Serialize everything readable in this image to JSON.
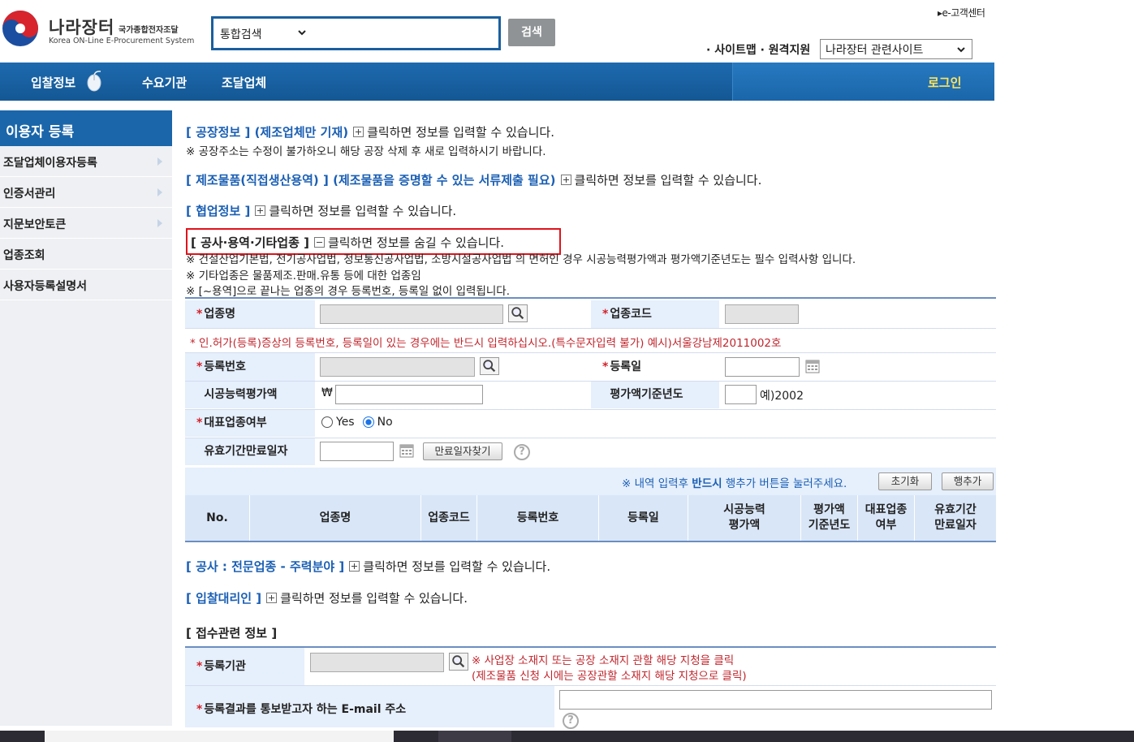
{
  "header": {
    "logo_title": "나라장터",
    "logo_subtitle": "국가종합전자조달",
    "logo_english": "Korea ON-Line E-Procurement System",
    "search_scope": "통합검색",
    "search_button": "검색",
    "customer_center": "e-고객센터",
    "top_links": "· 사이트맵 · 원격지원",
    "related_sites": "나라장터 관련사이트"
  },
  "nav": {
    "items": [
      "입찰정보",
      "수요기관",
      "조달업체"
    ],
    "login": "로그인"
  },
  "sidebar": {
    "title": "이용자 등록",
    "items": [
      "조달업체이용자등록",
      "인증서관리",
      "지문보안토큰",
      "업종조회",
      "사용자등록설명서"
    ]
  },
  "sections": {
    "factory": {
      "title": "[ 공장정보 ] (제조업체만 기재)",
      "hint": "클릭하면 정보를 입력할 수 있습니다.",
      "warning": "※ 공장주소는 수정이 불가하오니 해당 공장 삭제 후 새로 입력하시기 바랍니다."
    },
    "products": {
      "title": "[ 제조물품(직접생산용역) ] (제조물품을 증명할 수 있는 서류제출 필요)",
      "hint": "클릭하면 정보를 입력할 수 있습니다."
    },
    "coop": {
      "title": "[ 협업정보 ]",
      "hint": "클릭하면 정보를 입력할 수 있습니다."
    },
    "industry": {
      "title": "[ 공사·용역·기타업종 ]",
      "hint": "클릭하면 정보를 숨길 수 있습니다."
    },
    "notes": [
      "※ 건설산업기본법, 전기공사업법, 정보통신공사업법, 소방시설공사업법 의 면허인 경우 시공능력평가액과 평가액기준년도는 필수 입력사항 입니다.",
      "※ 기타업종은 물품제조.판매.유통 등에 대한 업종임",
      "※ [~용역]으로 끝나는 업종의 경우 등록번호, 등록일 없이 입력됩니다."
    ],
    "specialty": {
      "title": "[ 공사 : 전문업종 - 주력분야 ]",
      "hint": "클릭하면 정보를 입력할 수 있습니다."
    },
    "agent": {
      "title": "[ 입찰대리인 ]",
      "hint": "클릭하면 정보를 입력할 수 있습니다."
    },
    "reception": {
      "title": "[ 접수관련 정보 ]"
    }
  },
  "form": {
    "industry_name": "업종명",
    "industry_code": "업종코드",
    "license_note": "* 인.허가(등록)증상의 등록번호, 등록일이 있는 경우에는 반드시 입력하십시오.(특수문자입력 불가) 예시)서울강남제2011002호",
    "reg_number": "등록번호",
    "reg_date": "등록일",
    "capacity_amount": "시공능력평가액",
    "currency": "₩",
    "eval_year": "평가액기준년도",
    "eval_year_example": "예)2002",
    "main_industry": "대표업종여부",
    "yes": "Yes",
    "no": "No",
    "expiry": "유효기간만료일자",
    "find_expiry": "만료일자찾기",
    "bar_note_pre": "※ 내역 입력후 ",
    "bar_note_bold": "반드시",
    "bar_note_post": " 행추가 버튼을 눌러주세요.",
    "reset": "초기화",
    "add_row": "행추가"
  },
  "table": {
    "headers": [
      "No.",
      "업종명",
      "업종코드",
      "등록번호",
      "등록일",
      "시공능력\n평가액",
      "평가액\n기준년도",
      "대표업종\n여부",
      "유효기간\n만료일자"
    ]
  },
  "reception": {
    "agency": "등록기관",
    "agency_note1": "※ 사업장 소재지 또는 공장 소재지 관할 해당 지청을 클릭",
    "agency_note2": "(제조물품 신청 시에는 공장관할 소재지 해당 지청으로 클릭)",
    "email_label": "등록결과를 통보받고자 하는 E-mail 주소"
  },
  "colors": {
    "nav": "#1b66aa",
    "accent_blue": "#1a5fb4",
    "note_red": "#c0262d",
    "highlight_box": "#e0131b",
    "login": "#ffe45c"
  }
}
